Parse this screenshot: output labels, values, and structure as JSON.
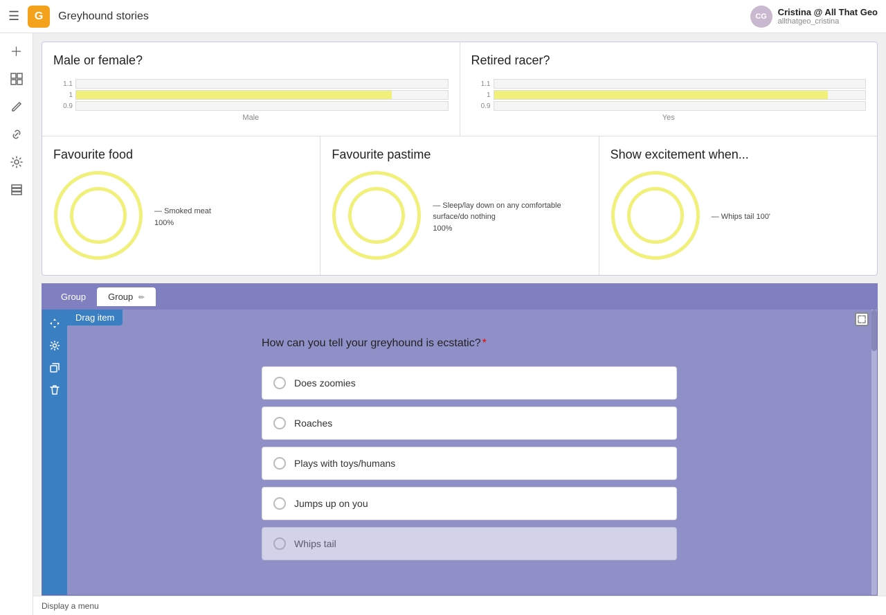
{
  "topbar": {
    "menu_label": "☰",
    "logo_text": "G",
    "title": "Greyhound stories",
    "user_name": "Cristina @ All That Geo",
    "user_handle": "allthatgeo_cristina",
    "avatar_initials": "CG"
  },
  "sidebar": {
    "icons": [
      {
        "name": "add-icon",
        "symbol": "+"
      },
      {
        "name": "grid-icon",
        "symbol": "⊞"
      },
      {
        "name": "paint-icon",
        "symbol": "✏"
      },
      {
        "name": "link-icon",
        "symbol": "🔗"
      },
      {
        "name": "settings-icon",
        "symbol": "⚙"
      },
      {
        "name": "layers-icon",
        "symbol": "⧉"
      }
    ]
  },
  "charts": {
    "male_or_female": {
      "title": "Male or female?",
      "bars": [
        {
          "y": "1.1",
          "width": 0
        },
        {
          "y": "1",
          "width": 85
        },
        {
          "y": "0.9",
          "width": 0
        }
      ],
      "x_label": "Male"
    },
    "retired_racer": {
      "title": "Retired racer?",
      "bars": [
        {
          "y": "1.1",
          "width": 0
        },
        {
          "y": "1",
          "width": 90
        },
        {
          "y": "0.9",
          "width": 0
        }
      ],
      "x_label": "Yes"
    },
    "favourite_food": {
      "title": "Favourite food",
      "legend_text": "Smoked meat",
      "legend_value": "100%"
    },
    "favourite_pastime": {
      "title": "Favourite pastime",
      "legend_text": "Sleep/lay down on any comfortable surface/do nothing",
      "legend_value": "100%"
    },
    "show_excitement": {
      "title": "Show excitement when...",
      "legend_text": "Whips tail 100'",
      "legend_value": ""
    }
  },
  "tabs": {
    "tab1_label": "Group",
    "tab2_label": "Group",
    "edit_icon": "✏"
  },
  "survey": {
    "drag_label": "Drag item",
    "question": "How can you tell your greyhound is ecstatic?",
    "required_marker": "*",
    "options": [
      {
        "label": "Does zoomies"
      },
      {
        "label": "Roaches"
      },
      {
        "label": "Plays with toys/humans"
      },
      {
        "label": "Jumps up on you"
      },
      {
        "label": "Whips tail"
      }
    ]
  },
  "bottom_status": {
    "label": "Display a menu"
  }
}
